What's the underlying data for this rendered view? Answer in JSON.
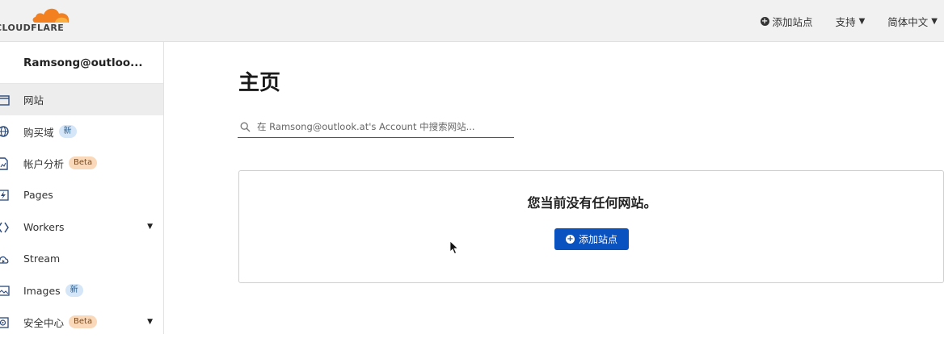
{
  "brand": {
    "logo_text": "CLOUDFLARE",
    "accent": "#f38020"
  },
  "topnav": {
    "add_site": "添加站点",
    "support": "支持",
    "language": "简体中文"
  },
  "sidebar": {
    "account_name": "Ramsong@outloo...",
    "items": [
      {
        "label": "网站",
        "icon": "browser-window-icon",
        "active": true
      },
      {
        "label": "购买域",
        "icon": "globe-icon",
        "badge": "新"
      },
      {
        "label": "帐户分析",
        "icon": "document-chart-icon",
        "badge": "Beta"
      },
      {
        "label": "Pages",
        "icon": "lightning-icon"
      },
      {
        "label": "Workers",
        "icon": "workers-icon",
        "has_submenu": true
      },
      {
        "label": "Stream",
        "icon": "cloud-play-icon"
      },
      {
        "label": "Images",
        "icon": "image-icon",
        "badge": "新"
      },
      {
        "label": "安全中心",
        "icon": "target-icon",
        "badge": "Beta",
        "has_submenu": true
      }
    ]
  },
  "main": {
    "title": "主页",
    "search_placeholder": "在 Ramsong@outlook.at's Account 中搜索网站...",
    "empty_message": "您当前没有任何网站。",
    "add_site_button": "添加站点"
  },
  "colors": {
    "primary_button": "#0a52bf",
    "badge_new": "#d4e6f7",
    "badge_beta": "#fad9bb"
  }
}
